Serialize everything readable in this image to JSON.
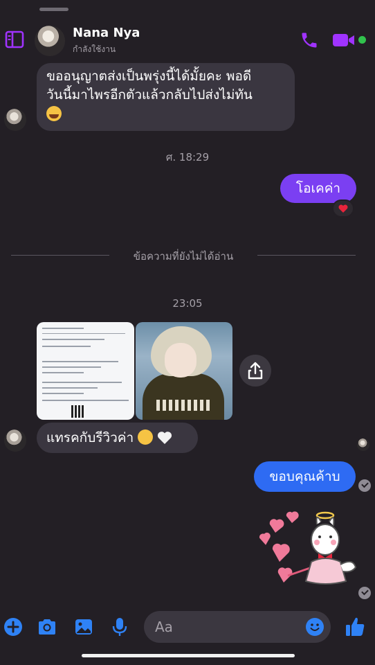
{
  "header": {
    "name": "Nana Nya",
    "status": "กำลังใช้งาน",
    "accent_color": "#a033ff",
    "online_color": "#31c24d"
  },
  "messages": {
    "m1_line1": "ขออนุญาตส่งเป็นพรุ่งนี้ได้มั้ยคะ พอดี",
    "m1_line2": "วันนี้มาไพรอีกตัวแล้วกลับไปส่งไม่ทัน",
    "timestamp1": "ศ. 18:29",
    "m2": "โอเคค่า",
    "m2_reaction": "red-heart",
    "unread_divider": "ข้อความที่ยังไม่ได้อ่าน",
    "timestamp2": "23:05",
    "m3": "แทรคกับรีวิวค่า",
    "m4": "ขอบคุณค้าบ"
  },
  "attachments": [
    {
      "kind": "receipt-image"
    },
    {
      "kind": "cosplay-photo"
    }
  ],
  "composer": {
    "placeholder": "Aa",
    "icons": [
      "plus-icon",
      "camera-icon",
      "image-icon",
      "mic-icon",
      "emoji-icon",
      "thumbs-up-icon"
    ],
    "icon_color": "#2f82f5"
  }
}
